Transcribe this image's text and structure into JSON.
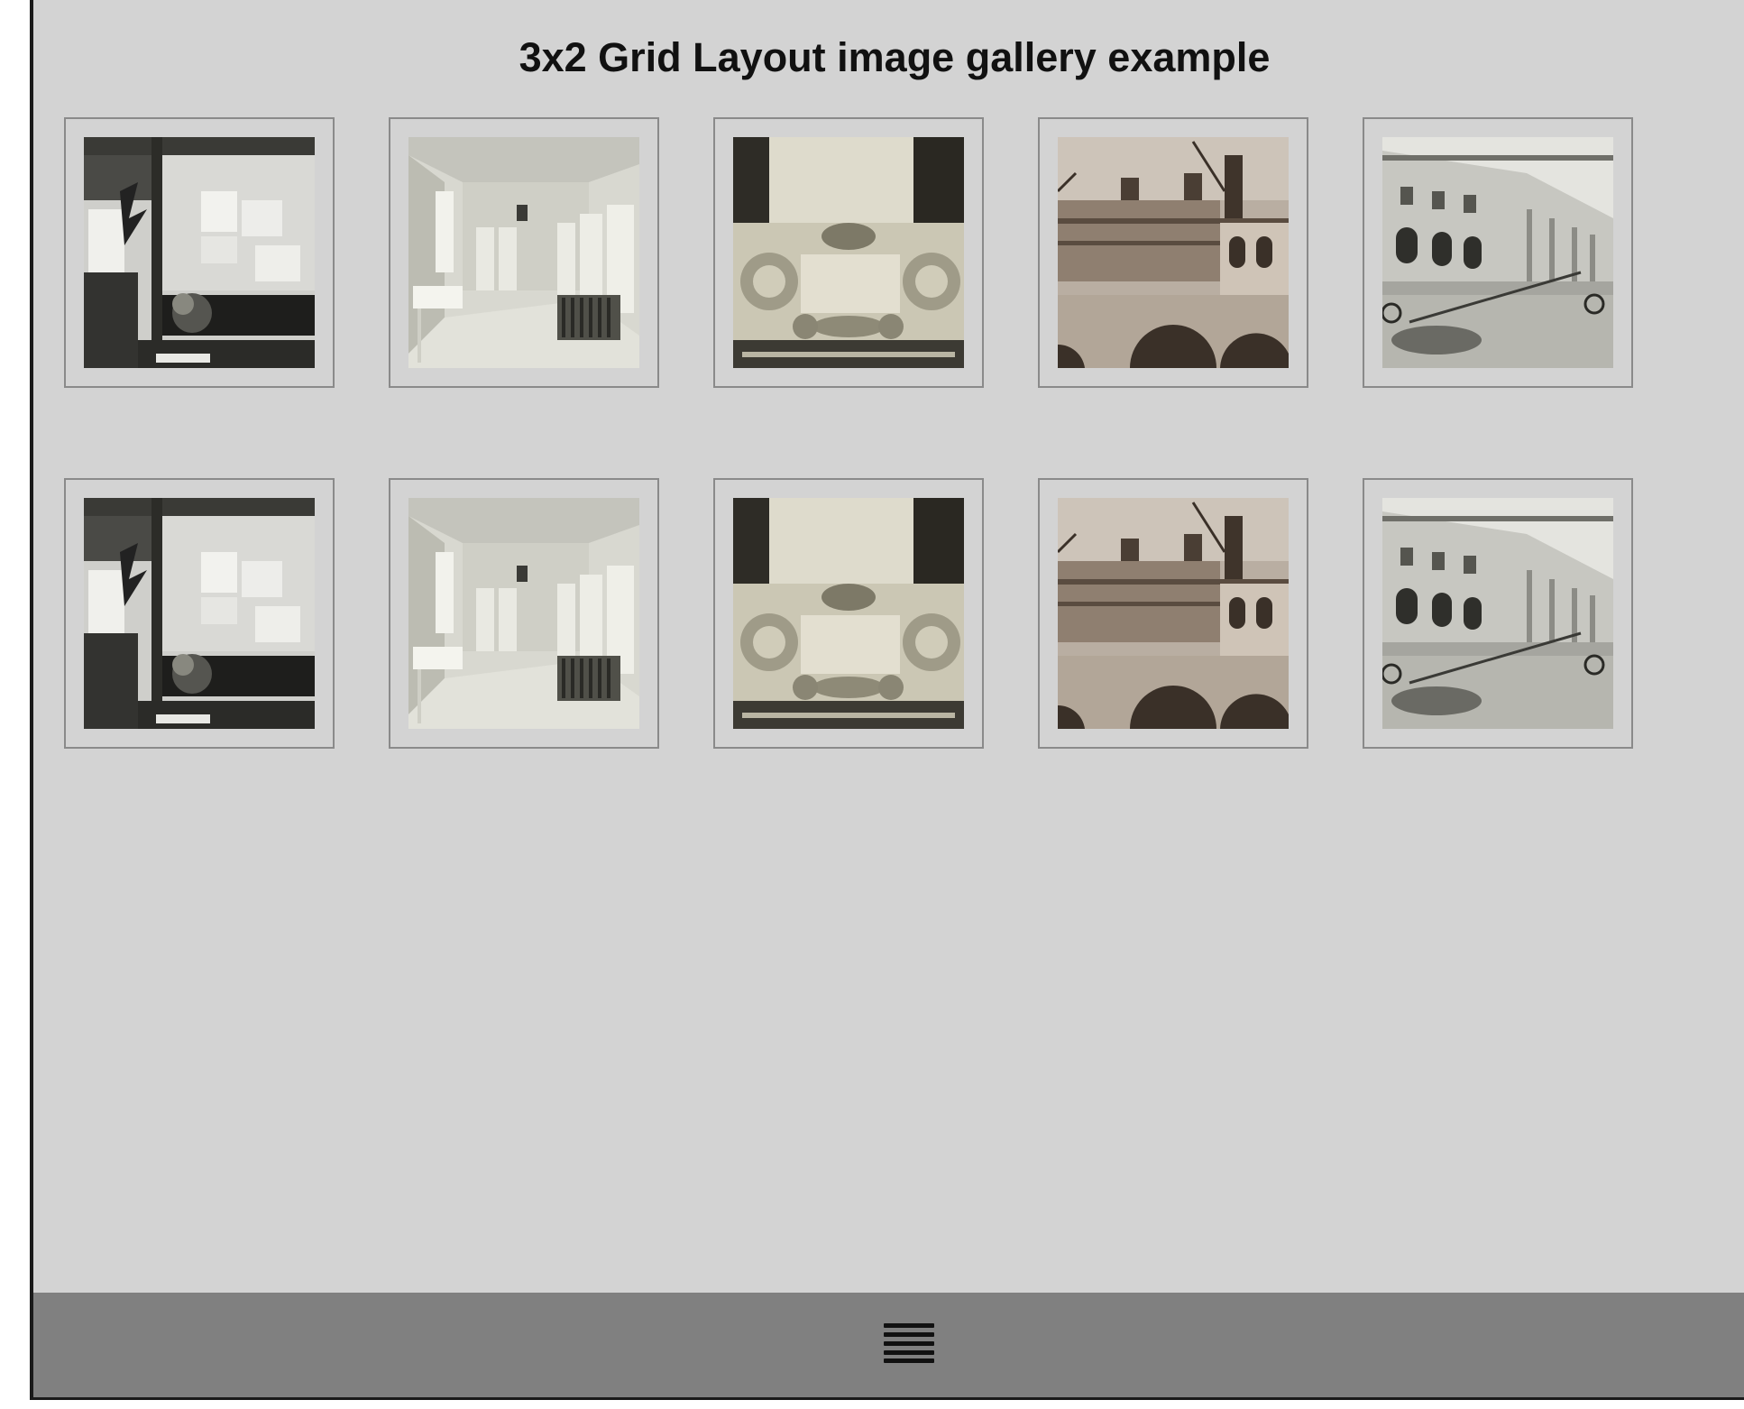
{
  "page": {
    "title": "3x2 Grid Layout image gallery example"
  },
  "gallery": {
    "rows": [
      [
        {
          "subject": "library-display-window-photo"
        },
        {
          "subject": "empty-room-radiator-photo"
        },
        {
          "subject": "carved-stone-cartouche-photo"
        },
        {
          "subject": "building-construction-scaffold-photo"
        },
        {
          "subject": "library-facade-photo"
        }
      ],
      [
        {
          "subject": "library-display-window-photo"
        },
        {
          "subject": "empty-room-radiator-photo"
        },
        {
          "subject": "carved-stone-cartouche-photo"
        },
        {
          "subject": "building-construction-scaffold-photo"
        },
        {
          "subject": "library-facade-photo"
        }
      ]
    ]
  },
  "footer": {
    "menu_icon": "hamburger-menu-icon"
  },
  "colors": {
    "background": "#d3d3d3",
    "footer": "#808080",
    "thumb_border": "#8a8a8a",
    "text": "#111111"
  }
}
